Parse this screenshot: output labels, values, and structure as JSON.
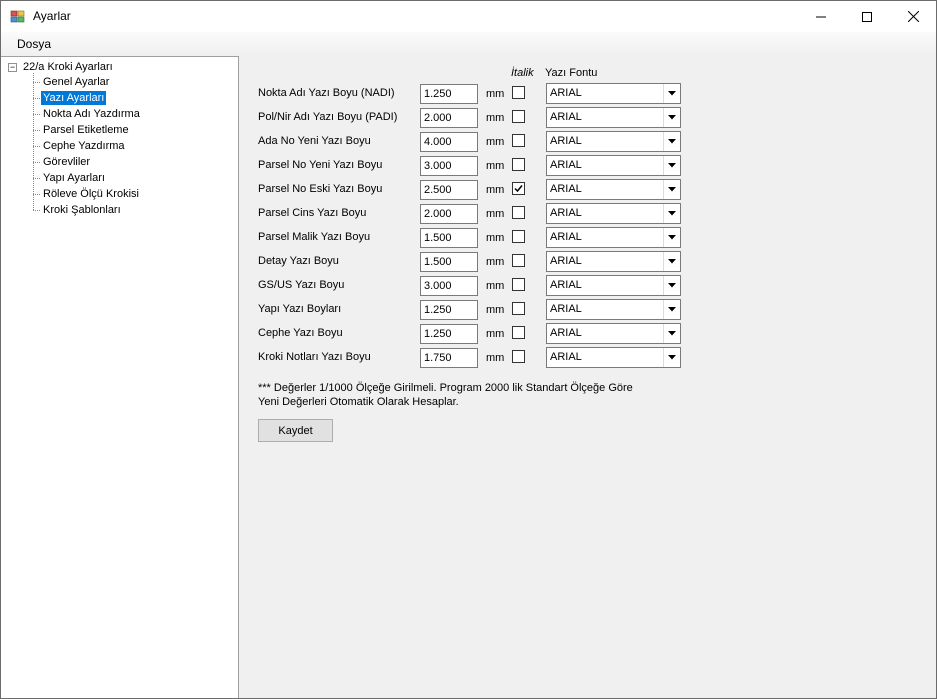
{
  "window": {
    "title": "Ayarlar"
  },
  "menu": {
    "file": "Dosya"
  },
  "tree": {
    "root": "22/a Kroki Ayarları",
    "items": [
      {
        "label": "Genel Ayarlar",
        "selected": false
      },
      {
        "label": "Yazı Ayarları",
        "selected": true
      },
      {
        "label": "Nokta Adı Yazdırma",
        "selected": false
      },
      {
        "label": "Parsel Etiketleme",
        "selected": false
      },
      {
        "label": "Cephe Yazdırma",
        "selected": false
      },
      {
        "label": "Görevliler",
        "selected": false
      },
      {
        "label": "Yapı Ayarları",
        "selected": false
      },
      {
        "label": "Röleve Ölçü Krokisi",
        "selected": false
      },
      {
        "label": "Kroki Şablonları",
        "selected": false
      }
    ]
  },
  "form": {
    "header_italic": "İtalik",
    "header_font": "Yazı Fontu",
    "unit": "mm",
    "rows": [
      {
        "label": "Nokta Adı Yazı Boyu (NADI)",
        "value": "1.250",
        "italic": false,
        "font": "ARIAL"
      },
      {
        "label": "Pol/Nir Adı Yazı Boyu (PADI)",
        "value": "2.000",
        "italic": false,
        "font": "ARIAL"
      },
      {
        "label": "Ada No Yeni Yazı Boyu",
        "value": "4.000",
        "italic": false,
        "font": "ARIAL"
      },
      {
        "label": "Parsel No Yeni Yazı Boyu",
        "value": "3.000",
        "italic": false,
        "font": "ARIAL"
      },
      {
        "label": "Parsel No Eski Yazı Boyu",
        "value": "2.500",
        "italic": true,
        "font": "ARIAL"
      },
      {
        "label": "Parsel Cins Yazı Boyu",
        "value": "2.000",
        "italic": false,
        "font": "ARIAL"
      },
      {
        "label": "Parsel Malik Yazı Boyu",
        "value": "1.500",
        "italic": false,
        "font": "ARIAL"
      },
      {
        "label": "Detay Yazı Boyu",
        "value": "1.500",
        "italic": false,
        "font": "ARIAL"
      },
      {
        "label": "GS/US Yazı Boyu",
        "value": "3.000",
        "italic": false,
        "font": "ARIAL"
      },
      {
        "label": "Yapı Yazı Boyları",
        "value": "1.250",
        "italic": false,
        "font": "ARIAL"
      },
      {
        "label": "Cephe Yazı Boyu",
        "value": "1.250",
        "italic": false,
        "font": "ARIAL"
      },
      {
        "label": "Kroki Notları Yazı Boyu",
        "value": "1.750",
        "italic": false,
        "font": "ARIAL"
      }
    ],
    "note_line1": "*** Değerler 1/1000 Ölçeğe Girilmeli.  Program 2000 lik Standart Ölçeğe Göre",
    "note_line2": "Yeni Değerleri Otomatik Olarak Hesaplar.",
    "save_label": "Kaydet"
  },
  "colors": {
    "selection": "#0078d7"
  }
}
